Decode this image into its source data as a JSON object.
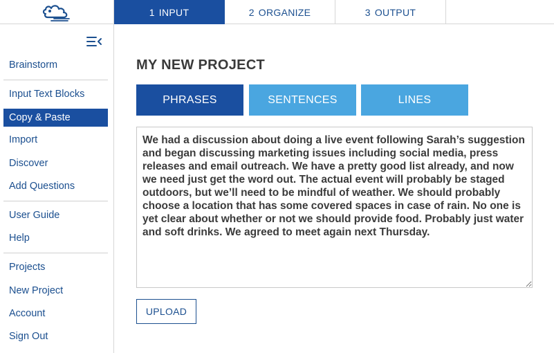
{
  "app": {
    "logo_name": "cloud-logo"
  },
  "tabs": [
    {
      "number": "1",
      "label": "INPUT"
    },
    {
      "number": "2",
      "label": "ORGANIZE"
    },
    {
      "number": "3",
      "label": "OUTPUT"
    }
  ],
  "sidebar": {
    "collapse_icon": "collapse-menu-icon",
    "items": [
      {
        "label": "Brainstorm"
      },
      {
        "label": "Input Text Blocks"
      },
      {
        "label": "Copy & Paste"
      },
      {
        "label": "Import"
      },
      {
        "label": "Discover"
      },
      {
        "label": "Add Questions"
      },
      {
        "label": "User Guide"
      },
      {
        "label": "Help"
      },
      {
        "label": "Projects"
      },
      {
        "label": "New Project"
      },
      {
        "label": "Account"
      },
      {
        "label": "Sign Out"
      }
    ]
  },
  "main": {
    "title": "MY NEW PROJECT",
    "modes": {
      "phrases": "PHRASES",
      "sentences": "SENTENCES",
      "lines": "LINES"
    },
    "text": "We had a discussion about doing a live event following Sarah’s suggestion and began discussing marketing issues including social media, press releases and email outreach. We have a pretty good list already, and now we need just get the word out. The actual event will probably be staged outdoors, but we’ll need to be mindful of weather. We should probably choose a location that has some covered spaces in case of rain. No one is yet clear about whether or not we should provide food. Probably just water and soft drinks. We agreed to meet again next Thursday.",
    "upload_label": "UPLOAD"
  },
  "colors": {
    "primary": "#1a4fa0",
    "secondary": "#4aa6e0",
    "text": "#1b4f8f"
  }
}
